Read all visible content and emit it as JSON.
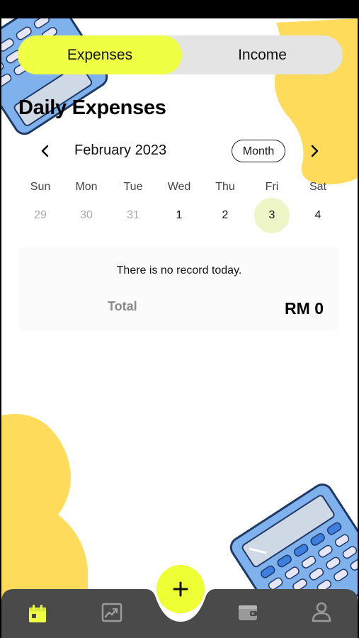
{
  "toggle": {
    "expenses_label": "Expenses",
    "income_label": "Income",
    "active": "Expenses"
  },
  "page_title": "Daily Expenses",
  "calendar": {
    "month_label": "February 2023",
    "view_button": "Month",
    "weekdays": [
      "Sun",
      "Mon",
      "Tue",
      "Wed",
      "Thu",
      "Fri",
      "Sat"
    ],
    "days": [
      {
        "label": "29",
        "state": "muted"
      },
      {
        "label": "30",
        "state": "muted"
      },
      {
        "label": "31",
        "state": "muted"
      },
      {
        "label": "1",
        "state": "normal"
      },
      {
        "label": "2",
        "state": "normal"
      },
      {
        "label": "3",
        "state": "selected"
      },
      {
        "label": "4",
        "state": "normal"
      }
    ]
  },
  "record": {
    "empty_message": "There is no record today.",
    "total_label": "Total",
    "total_value": "RM 0"
  },
  "tabbar": {
    "tabs": [
      {
        "icon": "calendar-icon",
        "active": true
      },
      {
        "icon": "chart-icon",
        "active": false
      },
      {
        "icon": "wallet-icon",
        "active": false
      },
      {
        "icon": "profile-icon",
        "active": false
      }
    ],
    "fab_icon": "plus-icon"
  },
  "colors": {
    "accent": "#eeff44",
    "selected_day": "#eef5c6",
    "tabbar": "#4a4a4a",
    "decor_yellow": "#ffdb5c",
    "calculator_blue": "#7fb2ec"
  }
}
